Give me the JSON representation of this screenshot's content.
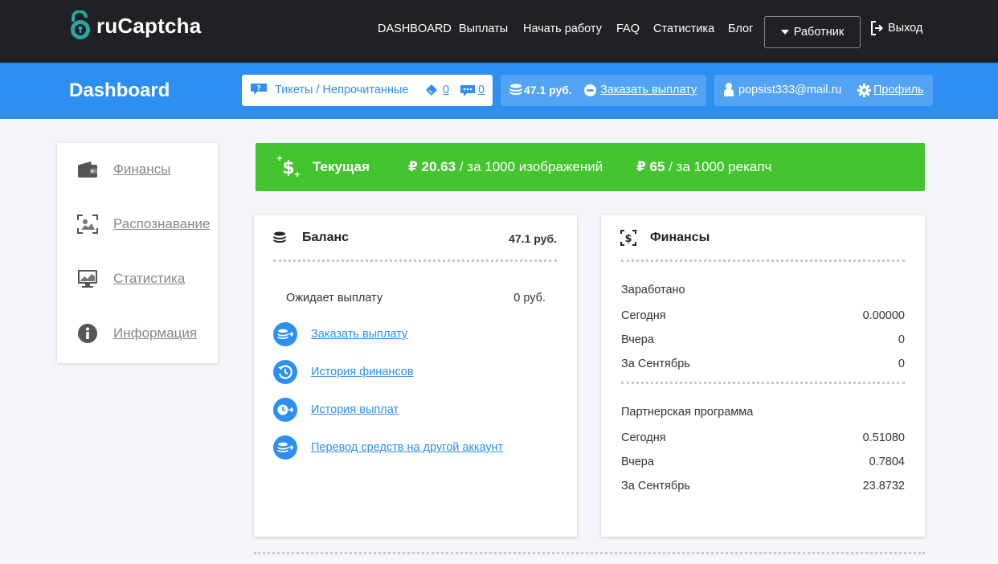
{
  "brand": {
    "name": "ruCaptcha"
  },
  "nav": {
    "items": [
      "DASHBOARD",
      "Выплаты",
      "Начать работу",
      "FAQ",
      "Статистика",
      "Блог"
    ],
    "role_label": "Работник",
    "logout_label": "Выход"
  },
  "header": {
    "title": "Dashboard",
    "tickets_label": "Тикеты / Непрочитанные",
    "tickets_count": "0",
    "messages_count": "0",
    "balance": "47.1 руб.",
    "payout_link": "Заказать выплату",
    "email": "popsist333@mail.ru",
    "profile_link": "Профиль"
  },
  "sidebar": {
    "items": [
      {
        "label": "Финансы",
        "icon": "wallet-icon"
      },
      {
        "label": "Распознавание",
        "icon": "recognition-icon"
      },
      {
        "label": "Статистика",
        "icon": "monitor-chart-icon"
      },
      {
        "label": "Информация",
        "icon": "info-icon"
      }
    ]
  },
  "rates": {
    "label": "Текущая",
    "image_rate": "₽ 20.63",
    "image_unit": "/ за 1000 изображений",
    "recaptcha_rate": "₽ 65",
    "recaptcha_unit": "/ за 1000 рекапч"
  },
  "balance_card": {
    "title": "Баланс",
    "amount": "47.1 руб.",
    "pending_label": "Ожидает выплату",
    "pending_value": "0 руб.",
    "links": [
      "Заказать выплату",
      "История финансов",
      "История выплат",
      "Перевод средств на другой аккаунт"
    ]
  },
  "finance_card": {
    "title": "Финансы",
    "earned_title": "Заработано",
    "earned_rows": [
      {
        "label": "Сегодня",
        "value": "0.00000"
      },
      {
        "label": "Вчера",
        "value": "0"
      },
      {
        "label": "За Сентябрь",
        "value": "0"
      }
    ],
    "partner_title": "Партнерская программа",
    "partner_rows": [
      {
        "label": "Сегодня",
        "value": "0.51080"
      },
      {
        "label": "Вчера",
        "value": "0.7804"
      },
      {
        "label": "За Сентябрь",
        "value": "23.8732"
      }
    ]
  },
  "colors": {
    "topbar": "#202124",
    "accent": "#2d8ff2",
    "rate_green": "#44c42f",
    "logo_teal": "#2aa6a3"
  }
}
